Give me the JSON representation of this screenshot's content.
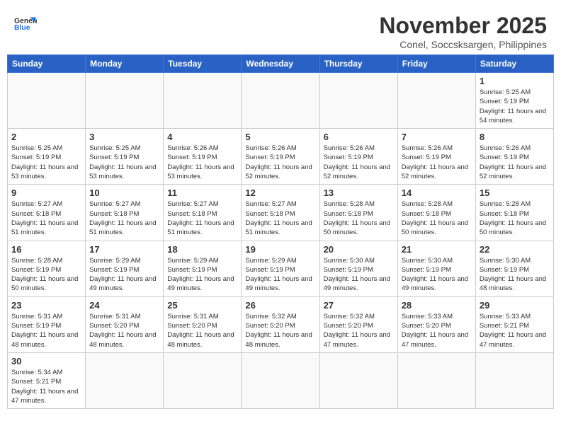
{
  "header": {
    "logo_line1": "General",
    "logo_line2": "Blue",
    "month": "November 2025",
    "location": "Conel, Soccsksargen, Philippines"
  },
  "weekdays": [
    "Sunday",
    "Monday",
    "Tuesday",
    "Wednesday",
    "Thursday",
    "Friday",
    "Saturday"
  ],
  "weeks": [
    [
      {
        "day": "",
        "sunrise": "",
        "sunset": "",
        "daylight": ""
      },
      {
        "day": "",
        "sunrise": "",
        "sunset": "",
        "daylight": ""
      },
      {
        "day": "",
        "sunrise": "",
        "sunset": "",
        "daylight": ""
      },
      {
        "day": "",
        "sunrise": "",
        "sunset": "",
        "daylight": ""
      },
      {
        "day": "",
        "sunrise": "",
        "sunset": "",
        "daylight": ""
      },
      {
        "day": "",
        "sunrise": "",
        "sunset": "",
        "daylight": ""
      },
      {
        "day": "1",
        "sunrise": "Sunrise: 5:25 AM",
        "sunset": "Sunset: 5:19 PM",
        "daylight": "Daylight: 11 hours and 54 minutes."
      }
    ],
    [
      {
        "day": "2",
        "sunrise": "Sunrise: 5:25 AM",
        "sunset": "Sunset: 5:19 PM",
        "daylight": "Daylight: 11 hours and 53 minutes."
      },
      {
        "day": "3",
        "sunrise": "Sunrise: 5:25 AM",
        "sunset": "Sunset: 5:19 PM",
        "daylight": "Daylight: 11 hours and 53 minutes."
      },
      {
        "day": "4",
        "sunrise": "Sunrise: 5:26 AM",
        "sunset": "Sunset: 5:19 PM",
        "daylight": "Daylight: 11 hours and 53 minutes."
      },
      {
        "day": "5",
        "sunrise": "Sunrise: 5:26 AM",
        "sunset": "Sunset: 5:19 PM",
        "daylight": "Daylight: 11 hours and 52 minutes."
      },
      {
        "day": "6",
        "sunrise": "Sunrise: 5:26 AM",
        "sunset": "Sunset: 5:19 PM",
        "daylight": "Daylight: 11 hours and 52 minutes."
      },
      {
        "day": "7",
        "sunrise": "Sunrise: 5:26 AM",
        "sunset": "Sunset: 5:19 PM",
        "daylight": "Daylight: 11 hours and 52 minutes."
      },
      {
        "day": "8",
        "sunrise": "Sunrise: 5:26 AM",
        "sunset": "Sunset: 5:19 PM",
        "daylight": "Daylight: 11 hours and 52 minutes."
      }
    ],
    [
      {
        "day": "9",
        "sunrise": "Sunrise: 5:27 AM",
        "sunset": "Sunset: 5:18 PM",
        "daylight": "Daylight: 11 hours and 51 minutes."
      },
      {
        "day": "10",
        "sunrise": "Sunrise: 5:27 AM",
        "sunset": "Sunset: 5:18 PM",
        "daylight": "Daylight: 11 hours and 51 minutes."
      },
      {
        "day": "11",
        "sunrise": "Sunrise: 5:27 AM",
        "sunset": "Sunset: 5:18 PM",
        "daylight": "Daylight: 11 hours and 51 minutes."
      },
      {
        "day": "12",
        "sunrise": "Sunrise: 5:27 AM",
        "sunset": "Sunset: 5:18 PM",
        "daylight": "Daylight: 11 hours and 51 minutes."
      },
      {
        "day": "13",
        "sunrise": "Sunrise: 5:28 AM",
        "sunset": "Sunset: 5:18 PM",
        "daylight": "Daylight: 11 hours and 50 minutes."
      },
      {
        "day": "14",
        "sunrise": "Sunrise: 5:28 AM",
        "sunset": "Sunset: 5:18 PM",
        "daylight": "Daylight: 11 hours and 50 minutes."
      },
      {
        "day": "15",
        "sunrise": "Sunrise: 5:28 AM",
        "sunset": "Sunset: 5:18 PM",
        "daylight": "Daylight: 11 hours and 50 minutes."
      }
    ],
    [
      {
        "day": "16",
        "sunrise": "Sunrise: 5:28 AM",
        "sunset": "Sunset: 5:19 PM",
        "daylight": "Daylight: 11 hours and 50 minutes."
      },
      {
        "day": "17",
        "sunrise": "Sunrise: 5:29 AM",
        "sunset": "Sunset: 5:19 PM",
        "daylight": "Daylight: 11 hours and 49 minutes."
      },
      {
        "day": "18",
        "sunrise": "Sunrise: 5:29 AM",
        "sunset": "Sunset: 5:19 PM",
        "daylight": "Daylight: 11 hours and 49 minutes."
      },
      {
        "day": "19",
        "sunrise": "Sunrise: 5:29 AM",
        "sunset": "Sunset: 5:19 PM",
        "daylight": "Daylight: 11 hours and 49 minutes."
      },
      {
        "day": "20",
        "sunrise": "Sunrise: 5:30 AM",
        "sunset": "Sunset: 5:19 PM",
        "daylight": "Daylight: 11 hours and 49 minutes."
      },
      {
        "day": "21",
        "sunrise": "Sunrise: 5:30 AM",
        "sunset": "Sunset: 5:19 PM",
        "daylight": "Daylight: 11 hours and 49 minutes."
      },
      {
        "day": "22",
        "sunrise": "Sunrise: 5:30 AM",
        "sunset": "Sunset: 5:19 PM",
        "daylight": "Daylight: 11 hours and 48 minutes."
      }
    ],
    [
      {
        "day": "23",
        "sunrise": "Sunrise: 5:31 AM",
        "sunset": "Sunset: 5:19 PM",
        "daylight": "Daylight: 11 hours and 48 minutes."
      },
      {
        "day": "24",
        "sunrise": "Sunrise: 5:31 AM",
        "sunset": "Sunset: 5:20 PM",
        "daylight": "Daylight: 11 hours and 48 minutes."
      },
      {
        "day": "25",
        "sunrise": "Sunrise: 5:31 AM",
        "sunset": "Sunset: 5:20 PM",
        "daylight": "Daylight: 11 hours and 48 minutes."
      },
      {
        "day": "26",
        "sunrise": "Sunrise: 5:32 AM",
        "sunset": "Sunset: 5:20 PM",
        "daylight": "Daylight: 11 hours and 48 minutes."
      },
      {
        "day": "27",
        "sunrise": "Sunrise: 5:32 AM",
        "sunset": "Sunset: 5:20 PM",
        "daylight": "Daylight: 11 hours and 47 minutes."
      },
      {
        "day": "28",
        "sunrise": "Sunrise: 5:33 AM",
        "sunset": "Sunset: 5:20 PM",
        "daylight": "Daylight: 11 hours and 47 minutes."
      },
      {
        "day": "29",
        "sunrise": "Sunrise: 5:33 AM",
        "sunset": "Sunset: 5:21 PM",
        "daylight": "Daylight: 11 hours and 47 minutes."
      }
    ],
    [
      {
        "day": "30",
        "sunrise": "Sunrise: 5:34 AM",
        "sunset": "Sunset: 5:21 PM",
        "daylight": "Daylight: 11 hours and 47 minutes."
      },
      {
        "day": "",
        "sunrise": "",
        "sunset": "",
        "daylight": ""
      },
      {
        "day": "",
        "sunrise": "",
        "sunset": "",
        "daylight": ""
      },
      {
        "day": "",
        "sunrise": "",
        "sunset": "",
        "daylight": ""
      },
      {
        "day": "",
        "sunrise": "",
        "sunset": "",
        "daylight": ""
      },
      {
        "day": "",
        "sunrise": "",
        "sunset": "",
        "daylight": ""
      },
      {
        "day": "",
        "sunrise": "",
        "sunset": "",
        "daylight": ""
      }
    ]
  ]
}
